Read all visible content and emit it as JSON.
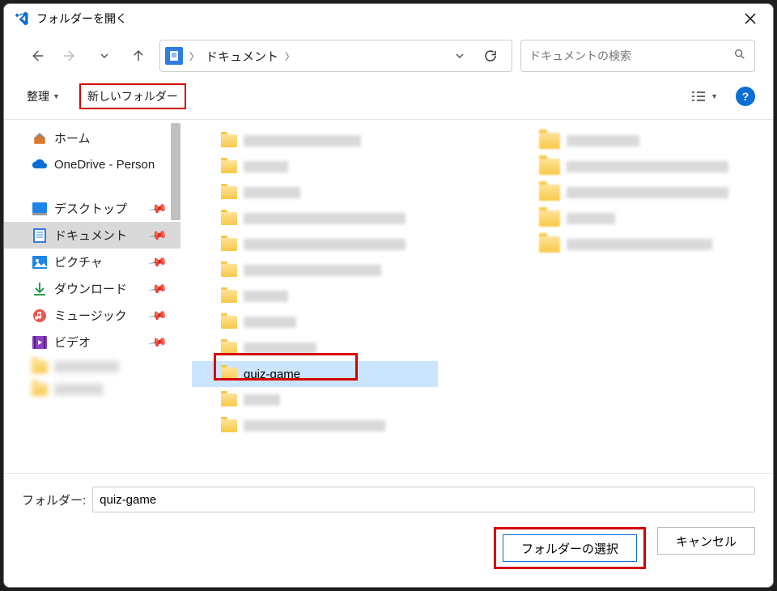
{
  "window": {
    "title": "フォルダーを開く"
  },
  "breadcrumb": {
    "segments": [
      "ドキュメント"
    ]
  },
  "search": {
    "placeholder": "ドキュメントの検索"
  },
  "toolbar": {
    "organize": "整理",
    "new_folder": "新しいフォルダー"
  },
  "sidebar": {
    "home": "ホーム",
    "onedrive": "OneDrive - Person",
    "desktop": "デスクトップ",
    "documents": "ドキュメント",
    "pictures": "ピクチャ",
    "downloads": "ダウンロード",
    "music": "ミュージック",
    "video": "ビデオ"
  },
  "files": {
    "selected": "quiz-game"
  },
  "footer": {
    "label": "フォルダー:",
    "value": "quiz-game",
    "select": "フォルダーの選択",
    "cancel": "キャンセル"
  }
}
